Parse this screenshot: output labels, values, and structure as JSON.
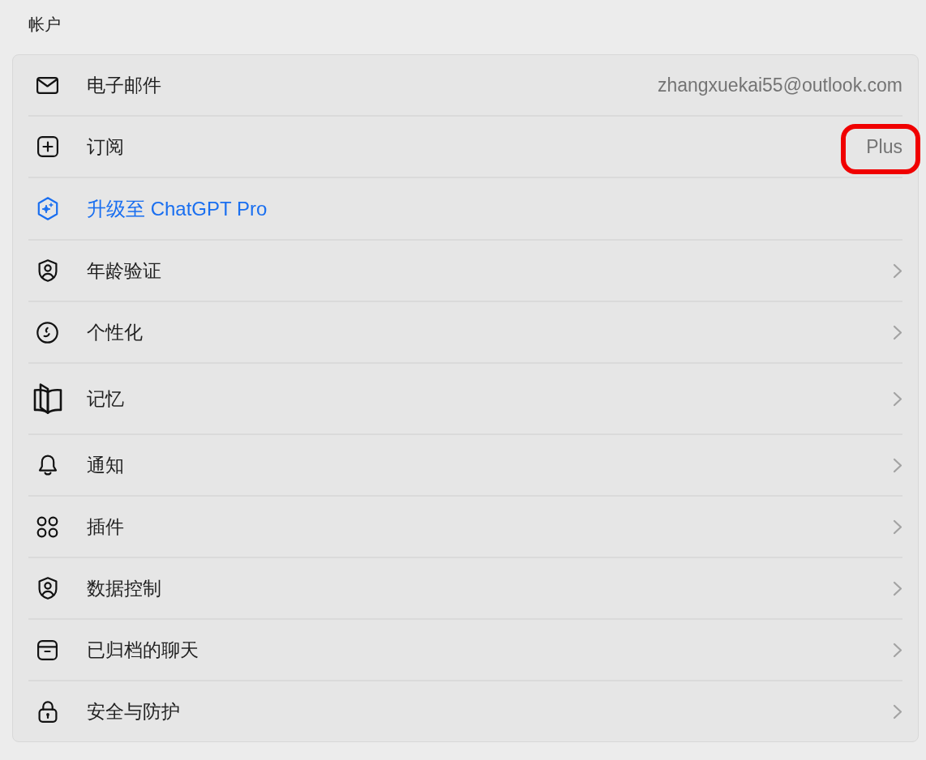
{
  "section_title": "帐户",
  "rows": [
    {
      "kind": "value",
      "label": "电子邮件",
      "value": "zhangxuekai55@outlook.com",
      "highlighted": false
    },
    {
      "kind": "value",
      "label": "订阅",
      "value": "Plus",
      "highlighted": true
    },
    {
      "kind": "link",
      "label": "升级至 ChatGPT Pro"
    },
    {
      "kind": "nav",
      "label": "年龄验证"
    },
    {
      "kind": "nav",
      "label": "个性化"
    },
    {
      "kind": "nav",
      "label": "记忆"
    },
    {
      "kind": "nav",
      "label": "通知"
    },
    {
      "kind": "nav",
      "label": "插件"
    },
    {
      "kind": "nav",
      "label": "数据控制"
    },
    {
      "kind": "nav",
      "label": "已归档的聊天"
    },
    {
      "kind": "nav",
      "label": "安全与防护"
    }
  ]
}
